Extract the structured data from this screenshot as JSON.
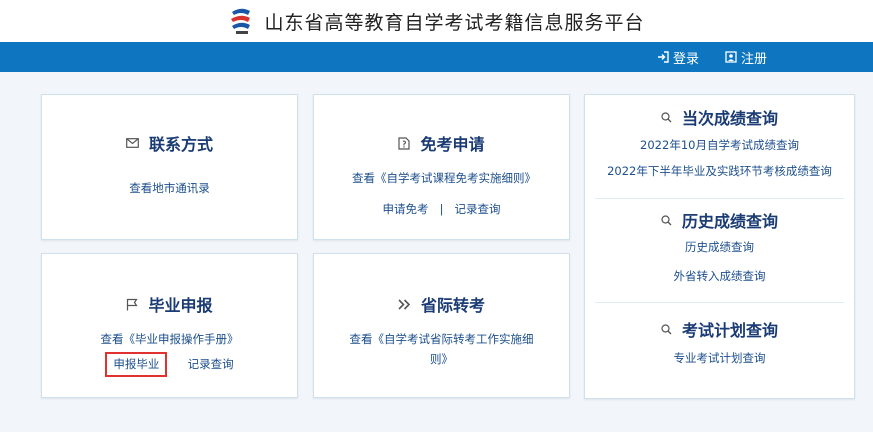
{
  "header": {
    "title": "山东省高等教育自学考试考籍信息服务平台"
  },
  "topbar": {
    "login_label": "登录",
    "register_label": "注册"
  },
  "contact": {
    "title": "联系方式",
    "link": "查看地市通讯录"
  },
  "exemption": {
    "title": "免考申请",
    "manual_link": "查看《自学考试课程免考实施细则》",
    "apply_link": "申请免考",
    "separator": "|",
    "record_link": "记录查询"
  },
  "graduation": {
    "title": "毕业申报",
    "manual_link": "查看《毕业申报操作手册》",
    "apply_link": "申报毕业",
    "record_link": "记录查询"
  },
  "transfer": {
    "title": "省际转考",
    "manual_link": "查看《自学考试省际转考工作实施细则》"
  },
  "current_scores": {
    "title": "当次成绩查询",
    "links": [
      "2022年10月自学考试成绩查询",
      "2022年下半年毕业及实践环节考核成绩查询"
    ]
  },
  "history_scores": {
    "title": "历史成绩查询",
    "links": [
      "历史成绩查询",
      "外省转入成绩查询"
    ]
  },
  "exam_plan": {
    "title": "考试计划查询",
    "links": [
      "专业考试计划查询"
    ]
  },
  "colors": {
    "topbar": "#0e76c0",
    "title_text": "#1a3b73",
    "link_text": "#1c4f8c",
    "highlight_border": "#e2322f"
  },
  "icons": {
    "contact": "envelope-icon",
    "exemption": "document-icon",
    "graduation": "flag-icon",
    "transfer": "double-chevron-icon",
    "search": "search-icon",
    "login": "login-icon",
    "register": "register-icon"
  }
}
